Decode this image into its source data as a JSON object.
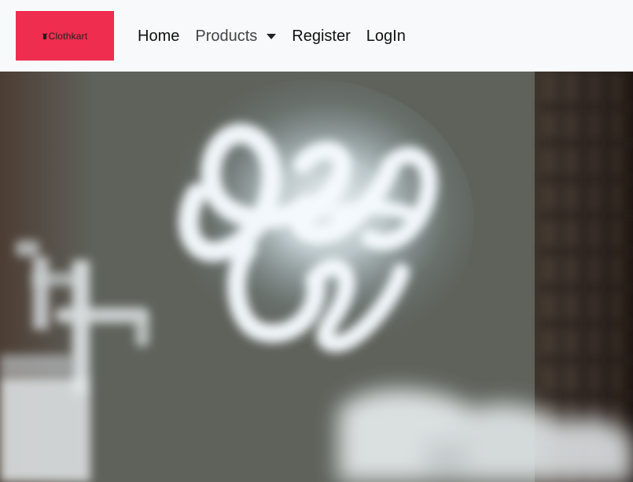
{
  "navbar": {
    "brand": {
      "text": "Clothkart",
      "icon": "shirt-icon",
      "background": "#ef2d4f"
    },
    "links": [
      {
        "label": "Home"
      },
      {
        "label": "Products",
        "dropdown": true
      },
      {
        "label": "Register"
      },
      {
        "label": "LogIn"
      }
    ]
  },
  "hero": {
    "image_subject": "blurred neon sign over dark wall with barber chair elements",
    "colors": {
      "neon": "#eef6fb",
      "wall_dark": "#3e3b33",
      "wall_mid": "#6b6d64",
      "accent_warm": "#5b463b"
    }
  }
}
